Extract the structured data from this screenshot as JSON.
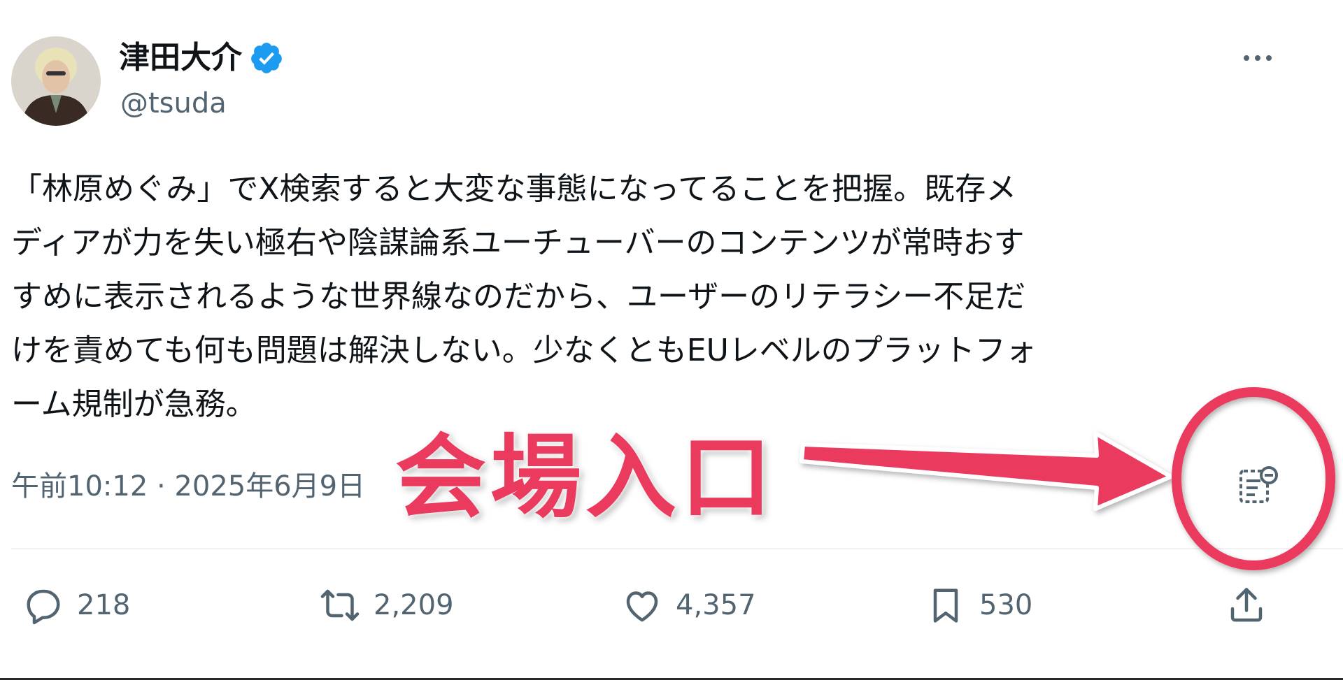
{
  "tweet": {
    "display_name": "津田大介",
    "handle": "@tsuda",
    "text_lines": [
      "「林原めぐみ」でX検索すると大変な事態になってることを把握。既存メ",
      "ディアが力を失い極右や陰謀論系ユーチューバーのコンテンツが常時おす",
      "すめに表示されるような世界線なのだから、ユーザーのリテラシー不足だ",
      "けを責めても何も問題は解決しない。少なくともEUレベルのプラットフォ",
      "ーム規制が急務。"
    ],
    "timestamp": "午前10:12 · 2025年6月9日"
  },
  "actions": {
    "reply_count": "218",
    "retweet_count": "2,209",
    "like_count": "4,357",
    "bookmark_count": "530"
  },
  "annotation": {
    "label": "会場入口",
    "color": "#ea3a5e"
  },
  "colors": {
    "verified": "#1d9bf0",
    "secondary_text": "#536471",
    "annotation": "#ea3a5e"
  }
}
